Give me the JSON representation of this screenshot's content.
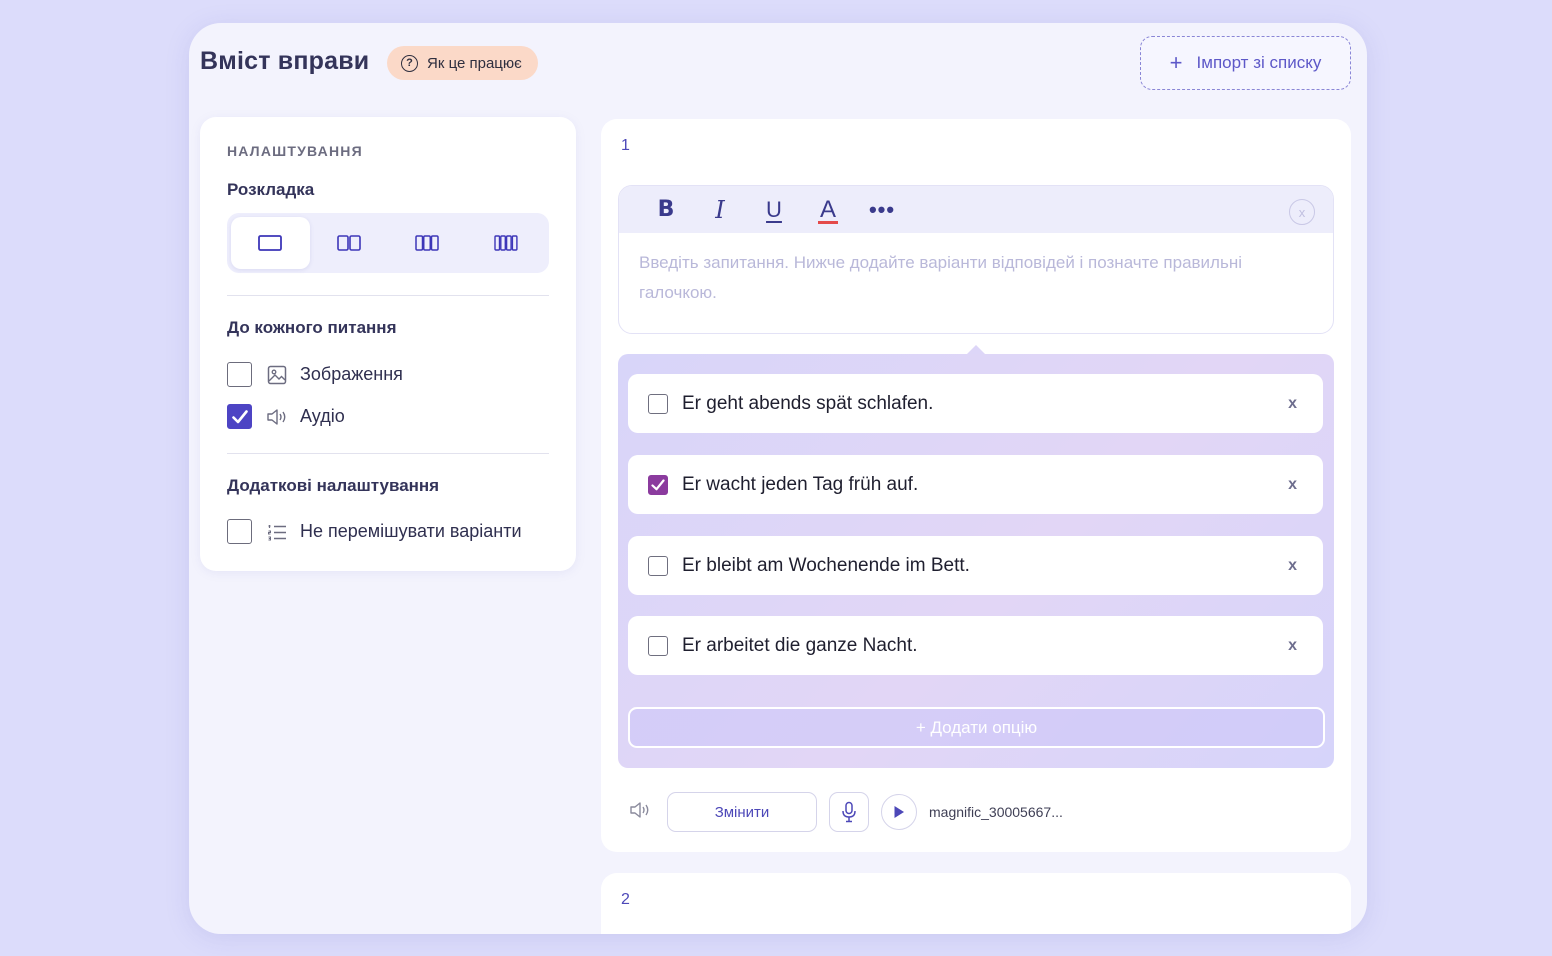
{
  "header": {
    "title": "Вміст вправи",
    "how_it_works": "Як це працює",
    "import_label": "Імпорт зі списку"
  },
  "settings": {
    "heading": "НАЛАШТУВАННЯ",
    "layout_label": "Розкладка",
    "layouts": [
      "1 column",
      "2 columns",
      "3 columns",
      "4 columns"
    ],
    "layout_selected": 0,
    "per_question_label": "До кожного питання",
    "image_label": "Зображення",
    "image_checked": false,
    "audio_label": "Аудіо",
    "audio_checked": true,
    "extra_label": "Додаткові налаштування",
    "no_shuffle_label": "Не перемішувати варіанти",
    "no_shuffle_checked": false
  },
  "question1": {
    "number": "1",
    "placeholder": "Введіть запитання. Нижче додайте варіанти відповідей і позначте правильні галочкою.",
    "toolbar": {
      "bold": "B",
      "italic": "I",
      "underline": "U",
      "color": "A",
      "more": "•••",
      "close": "x"
    },
    "options": [
      {
        "text": "Er geht abends spät schlafen.",
        "correct": false,
        "remove": "x"
      },
      {
        "text": "Er wacht jeden Tag früh auf.",
        "correct": true,
        "remove": "x"
      },
      {
        "text": "Er bleibt am Wochenende im Bett.",
        "correct": false,
        "remove": "x"
      },
      {
        "text": "Er arbeitet die ganze Nacht.",
        "correct": false,
        "remove": "x"
      }
    ],
    "add_option": "+ Додати опцію",
    "audio": {
      "change_label": "Змінити",
      "file_name": "magnific_30005667..."
    }
  },
  "question2": {
    "number": "2"
  },
  "colors": {
    "accent": "#4d44c4",
    "correct_check": "#8b3b9e",
    "how_bg": "#fbd9c8"
  }
}
